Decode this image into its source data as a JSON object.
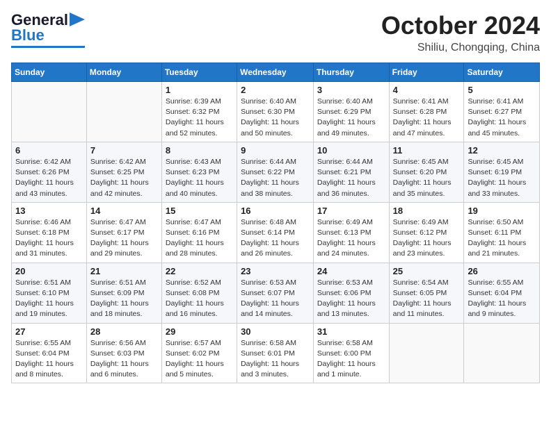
{
  "header": {
    "logo_general": "General",
    "logo_blue": "Blue",
    "month": "October 2024",
    "location": "Shiliu, Chongqing, China"
  },
  "columns": [
    "Sunday",
    "Monday",
    "Tuesday",
    "Wednesday",
    "Thursday",
    "Friday",
    "Saturday"
  ],
  "weeks": [
    [
      {
        "day": "",
        "detail": ""
      },
      {
        "day": "",
        "detail": ""
      },
      {
        "day": "1",
        "detail": "Sunrise: 6:39 AM\nSunset: 6:32 PM\nDaylight: 11 hours and 52 minutes."
      },
      {
        "day": "2",
        "detail": "Sunrise: 6:40 AM\nSunset: 6:30 PM\nDaylight: 11 hours and 50 minutes."
      },
      {
        "day": "3",
        "detail": "Sunrise: 6:40 AM\nSunset: 6:29 PM\nDaylight: 11 hours and 49 minutes."
      },
      {
        "day": "4",
        "detail": "Sunrise: 6:41 AM\nSunset: 6:28 PM\nDaylight: 11 hours and 47 minutes."
      },
      {
        "day": "5",
        "detail": "Sunrise: 6:41 AM\nSunset: 6:27 PM\nDaylight: 11 hours and 45 minutes."
      }
    ],
    [
      {
        "day": "6",
        "detail": "Sunrise: 6:42 AM\nSunset: 6:26 PM\nDaylight: 11 hours and 43 minutes."
      },
      {
        "day": "7",
        "detail": "Sunrise: 6:42 AM\nSunset: 6:25 PM\nDaylight: 11 hours and 42 minutes."
      },
      {
        "day": "8",
        "detail": "Sunrise: 6:43 AM\nSunset: 6:23 PM\nDaylight: 11 hours and 40 minutes."
      },
      {
        "day": "9",
        "detail": "Sunrise: 6:44 AM\nSunset: 6:22 PM\nDaylight: 11 hours and 38 minutes."
      },
      {
        "day": "10",
        "detail": "Sunrise: 6:44 AM\nSunset: 6:21 PM\nDaylight: 11 hours and 36 minutes."
      },
      {
        "day": "11",
        "detail": "Sunrise: 6:45 AM\nSunset: 6:20 PM\nDaylight: 11 hours and 35 minutes."
      },
      {
        "day": "12",
        "detail": "Sunrise: 6:45 AM\nSunset: 6:19 PM\nDaylight: 11 hours and 33 minutes."
      }
    ],
    [
      {
        "day": "13",
        "detail": "Sunrise: 6:46 AM\nSunset: 6:18 PM\nDaylight: 11 hours and 31 minutes."
      },
      {
        "day": "14",
        "detail": "Sunrise: 6:47 AM\nSunset: 6:17 PM\nDaylight: 11 hours and 29 minutes."
      },
      {
        "day": "15",
        "detail": "Sunrise: 6:47 AM\nSunset: 6:16 PM\nDaylight: 11 hours and 28 minutes."
      },
      {
        "day": "16",
        "detail": "Sunrise: 6:48 AM\nSunset: 6:14 PM\nDaylight: 11 hours and 26 minutes."
      },
      {
        "day": "17",
        "detail": "Sunrise: 6:49 AM\nSunset: 6:13 PM\nDaylight: 11 hours and 24 minutes."
      },
      {
        "day": "18",
        "detail": "Sunrise: 6:49 AM\nSunset: 6:12 PM\nDaylight: 11 hours and 23 minutes."
      },
      {
        "day": "19",
        "detail": "Sunrise: 6:50 AM\nSunset: 6:11 PM\nDaylight: 11 hours and 21 minutes."
      }
    ],
    [
      {
        "day": "20",
        "detail": "Sunrise: 6:51 AM\nSunset: 6:10 PM\nDaylight: 11 hours and 19 minutes."
      },
      {
        "day": "21",
        "detail": "Sunrise: 6:51 AM\nSunset: 6:09 PM\nDaylight: 11 hours and 18 minutes."
      },
      {
        "day": "22",
        "detail": "Sunrise: 6:52 AM\nSunset: 6:08 PM\nDaylight: 11 hours and 16 minutes."
      },
      {
        "day": "23",
        "detail": "Sunrise: 6:53 AM\nSunset: 6:07 PM\nDaylight: 11 hours and 14 minutes."
      },
      {
        "day": "24",
        "detail": "Sunrise: 6:53 AM\nSunset: 6:06 PM\nDaylight: 11 hours and 13 minutes."
      },
      {
        "day": "25",
        "detail": "Sunrise: 6:54 AM\nSunset: 6:05 PM\nDaylight: 11 hours and 11 minutes."
      },
      {
        "day": "26",
        "detail": "Sunrise: 6:55 AM\nSunset: 6:04 PM\nDaylight: 11 hours and 9 minutes."
      }
    ],
    [
      {
        "day": "27",
        "detail": "Sunrise: 6:55 AM\nSunset: 6:04 PM\nDaylight: 11 hours and 8 minutes."
      },
      {
        "day": "28",
        "detail": "Sunrise: 6:56 AM\nSunset: 6:03 PM\nDaylight: 11 hours and 6 minutes."
      },
      {
        "day": "29",
        "detail": "Sunrise: 6:57 AM\nSunset: 6:02 PM\nDaylight: 11 hours and 5 minutes."
      },
      {
        "day": "30",
        "detail": "Sunrise: 6:58 AM\nSunset: 6:01 PM\nDaylight: 11 hours and 3 minutes."
      },
      {
        "day": "31",
        "detail": "Sunrise: 6:58 AM\nSunset: 6:00 PM\nDaylight: 11 hours and 1 minute."
      },
      {
        "day": "",
        "detail": ""
      },
      {
        "day": "",
        "detail": ""
      }
    ]
  ]
}
